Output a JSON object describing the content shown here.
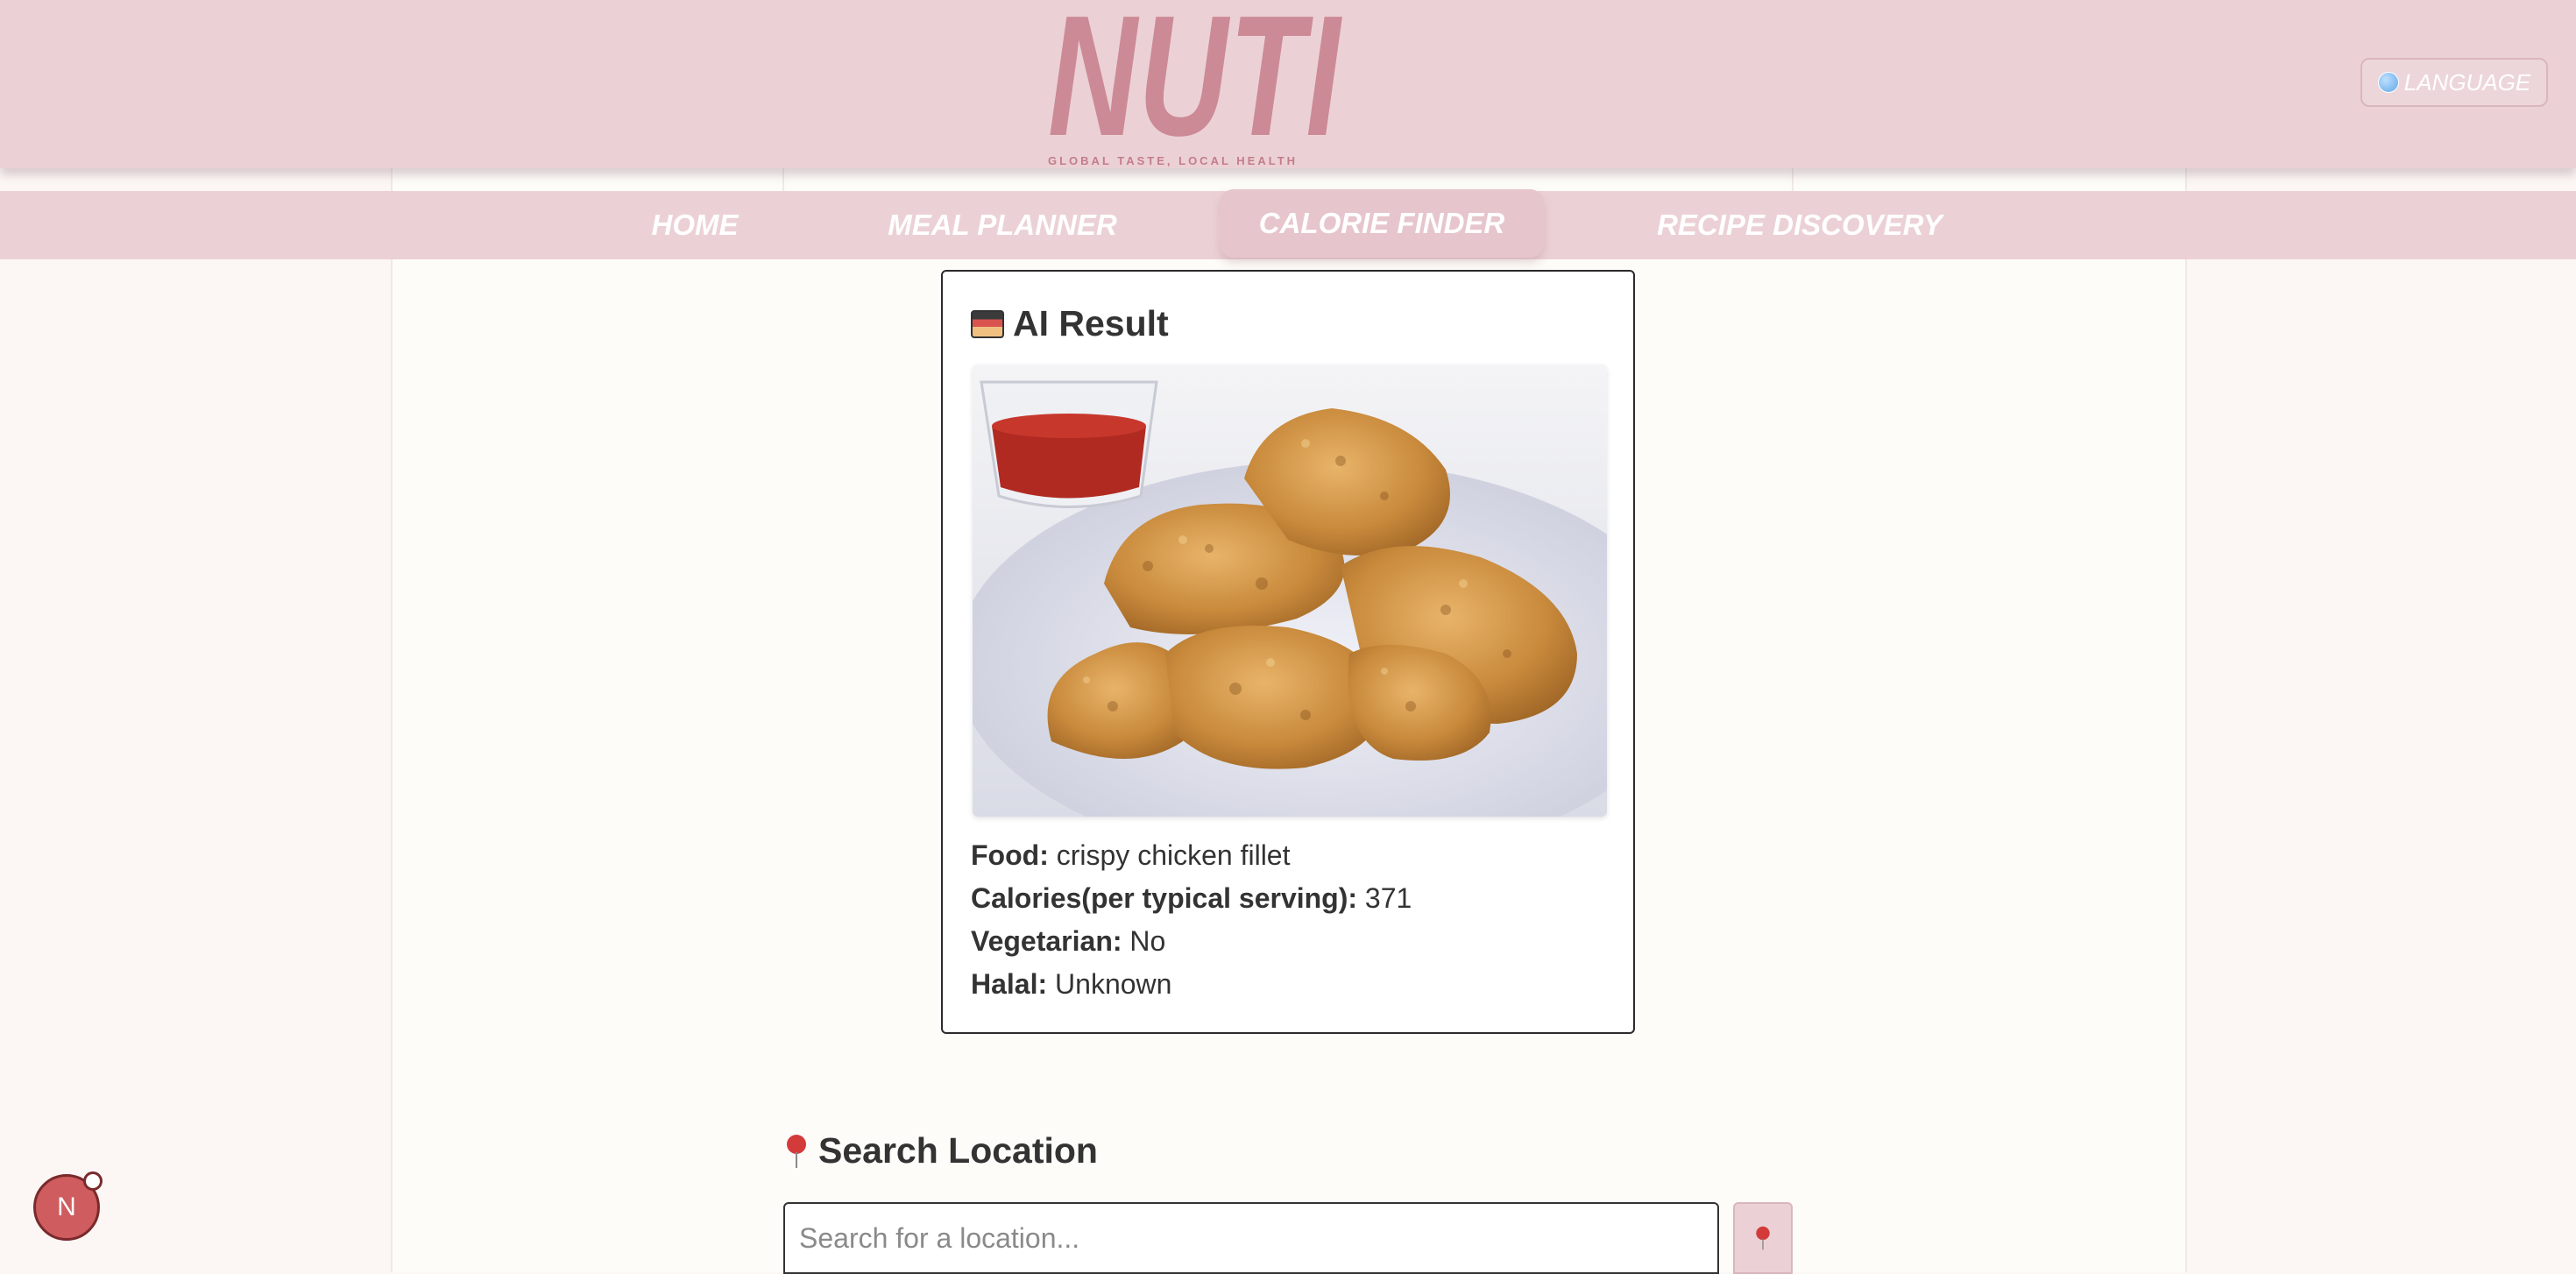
{
  "header": {
    "logo_text": "NUTI",
    "tagline": "GLOBAL TASTE, LOCAL HEALTH",
    "language_label": "LANGUAGE"
  },
  "nav": {
    "items": [
      {
        "label": "HOME"
      },
      {
        "label": "MEAL PLANNER"
      },
      {
        "label": "CALORIE FINDER",
        "active": true
      },
      {
        "label": "RECIPE DISCOVERY"
      }
    ]
  },
  "result": {
    "title": "AI Result",
    "image_alt": "crispy chicken fillet",
    "food_label": "Food:",
    "food_value": "crispy chicken fillet",
    "calories_label": "Calories(per typical serving):",
    "calories_value": "371",
    "vegetarian_label": "Vegetarian:",
    "vegetarian_value": "No",
    "halal_label": "Halal:",
    "halal_value": "Unknown"
  },
  "search": {
    "title": "Search Location",
    "placeholder": "Search for a location..."
  },
  "avatar": {
    "initial": "N"
  },
  "colors": {
    "header_bg": "#ebd1d5",
    "logo": "#cc8a96",
    "page_bg": "#fdfcf9"
  }
}
